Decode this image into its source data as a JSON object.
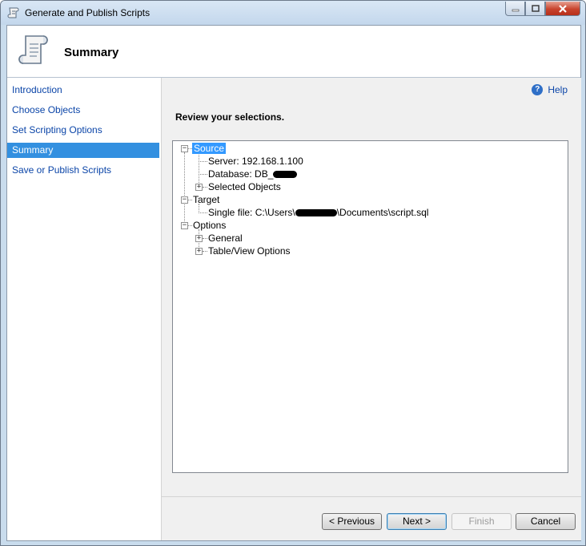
{
  "window": {
    "title": "Generate and Publish Scripts"
  },
  "header": {
    "title": "Summary"
  },
  "nav": {
    "items": [
      {
        "label": "Introduction"
      },
      {
        "label": "Choose Objects"
      },
      {
        "label": "Set Scripting Options"
      },
      {
        "label": "Summary",
        "selected": true
      },
      {
        "label": "Save or Publish Scripts"
      }
    ]
  },
  "main": {
    "help_label": "Help",
    "subtitle": "Review your selections.",
    "tree": {
      "source": "Source",
      "server": "Server: 192.168.1.100",
      "database": "Database: DB_",
      "selected_objects": "Selected Objects",
      "target": "Target",
      "single_file_prefix": "Single file: C:\\Users\\",
      "single_file_suffix": "\\Documents\\script.sql",
      "options": "Options",
      "general": "General",
      "table_view_options": "Table/View Options"
    }
  },
  "buttons": {
    "previous": "< Previous",
    "next": "Next >",
    "finish": "Finish",
    "cancel": "Cancel"
  },
  "colors": {
    "selection": "#3390e0",
    "link": "#0b45a8",
    "titlebar": "#c9dced"
  }
}
